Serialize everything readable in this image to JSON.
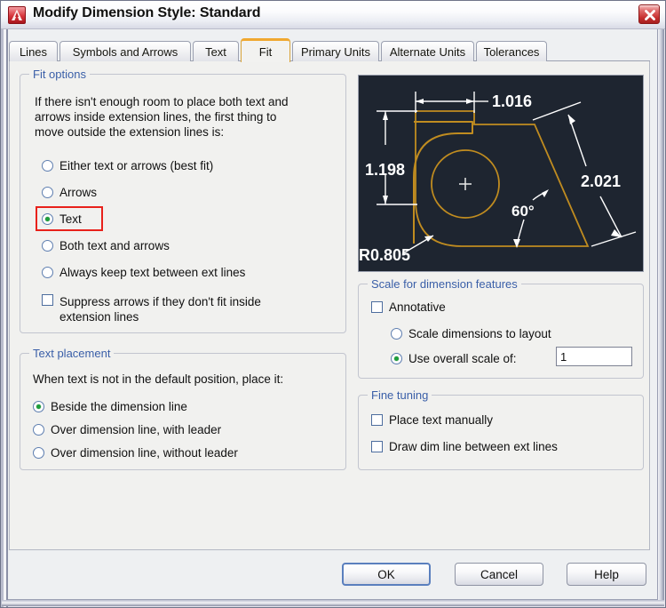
{
  "window": {
    "title": "Modify Dimension Style: Standard",
    "icon": "autocad-logo-icon",
    "close_label": "✕"
  },
  "tabs": [
    {
      "label": "Lines",
      "active": false
    },
    {
      "label": "Symbols and Arrows",
      "active": false
    },
    {
      "label": "Text",
      "active": false
    },
    {
      "label": "Fit",
      "active": true
    },
    {
      "label": "Primary Units",
      "active": false
    },
    {
      "label": "Alternate Units",
      "active": false
    },
    {
      "label": "Tolerances",
      "active": false
    }
  ],
  "fit_options": {
    "legend": "Fit options",
    "description_line1": "If there isn't enough room to place both text and",
    "description_line2": "arrows inside extension lines, the first thing to",
    "description_line3": "move outside the extension lines is:",
    "radios": [
      {
        "label": "Either text or arrows (best fit)",
        "checked": false
      },
      {
        "label": "Arrows",
        "checked": false
      },
      {
        "label": "Text",
        "checked": true,
        "highlighted": true
      },
      {
        "label": "Both text and arrows",
        "checked": false
      },
      {
        "label": "Always keep text between ext lines",
        "checked": false
      }
    ],
    "suppress_checkbox": {
      "line1": "Suppress arrows if they don't fit inside",
      "line2": "extension lines",
      "checked": false
    }
  },
  "text_placement": {
    "legend": "Text placement",
    "description": "When text is not in the default position, place it:",
    "radios": [
      {
        "label": "Beside the dimension line",
        "checked": true
      },
      {
        "label": "Over dimension line, with leader",
        "checked": false
      },
      {
        "label": "Over dimension line, without leader",
        "checked": false
      }
    ]
  },
  "scale_for_dimension_features": {
    "legend": "Scale for dimension features",
    "annotative": {
      "label": "Annotative",
      "checked": false
    },
    "radios": [
      {
        "label": "Scale dimensions to layout",
        "checked": false
      },
      {
        "label": "Use overall scale of:",
        "checked": true
      }
    ],
    "overall_scale_value": "1",
    "spinner_up": "▲",
    "spinner_down": "▼"
  },
  "fine_tuning": {
    "legend": "Fine tuning",
    "checkboxes": [
      {
        "label": "Place text manually",
        "checked": false
      },
      {
        "label": "Draw dim line between ext lines",
        "checked": false
      }
    ]
  },
  "preview": {
    "name": "dimension-style-preview",
    "dimensions": {
      "horizontal_top": "1.016",
      "vertical_left": "1.198",
      "radius": "R0.805",
      "angle": "60°",
      "diagonal_right": "2.021"
    },
    "colors": {
      "background": "#1e2530",
      "geometry": "#c08c20",
      "annotation": "#ffffff"
    }
  },
  "buttons": [
    {
      "label": "OK",
      "default": true
    },
    {
      "label": "Cancel",
      "default": false
    },
    {
      "label": "Help",
      "default": false
    }
  ],
  "colors": {
    "group_legend": "#3a5fa8",
    "highlight_box": "#e8211b",
    "active_tab_accent": "#f0a830",
    "radio_dot": "#1d9e3c"
  }
}
